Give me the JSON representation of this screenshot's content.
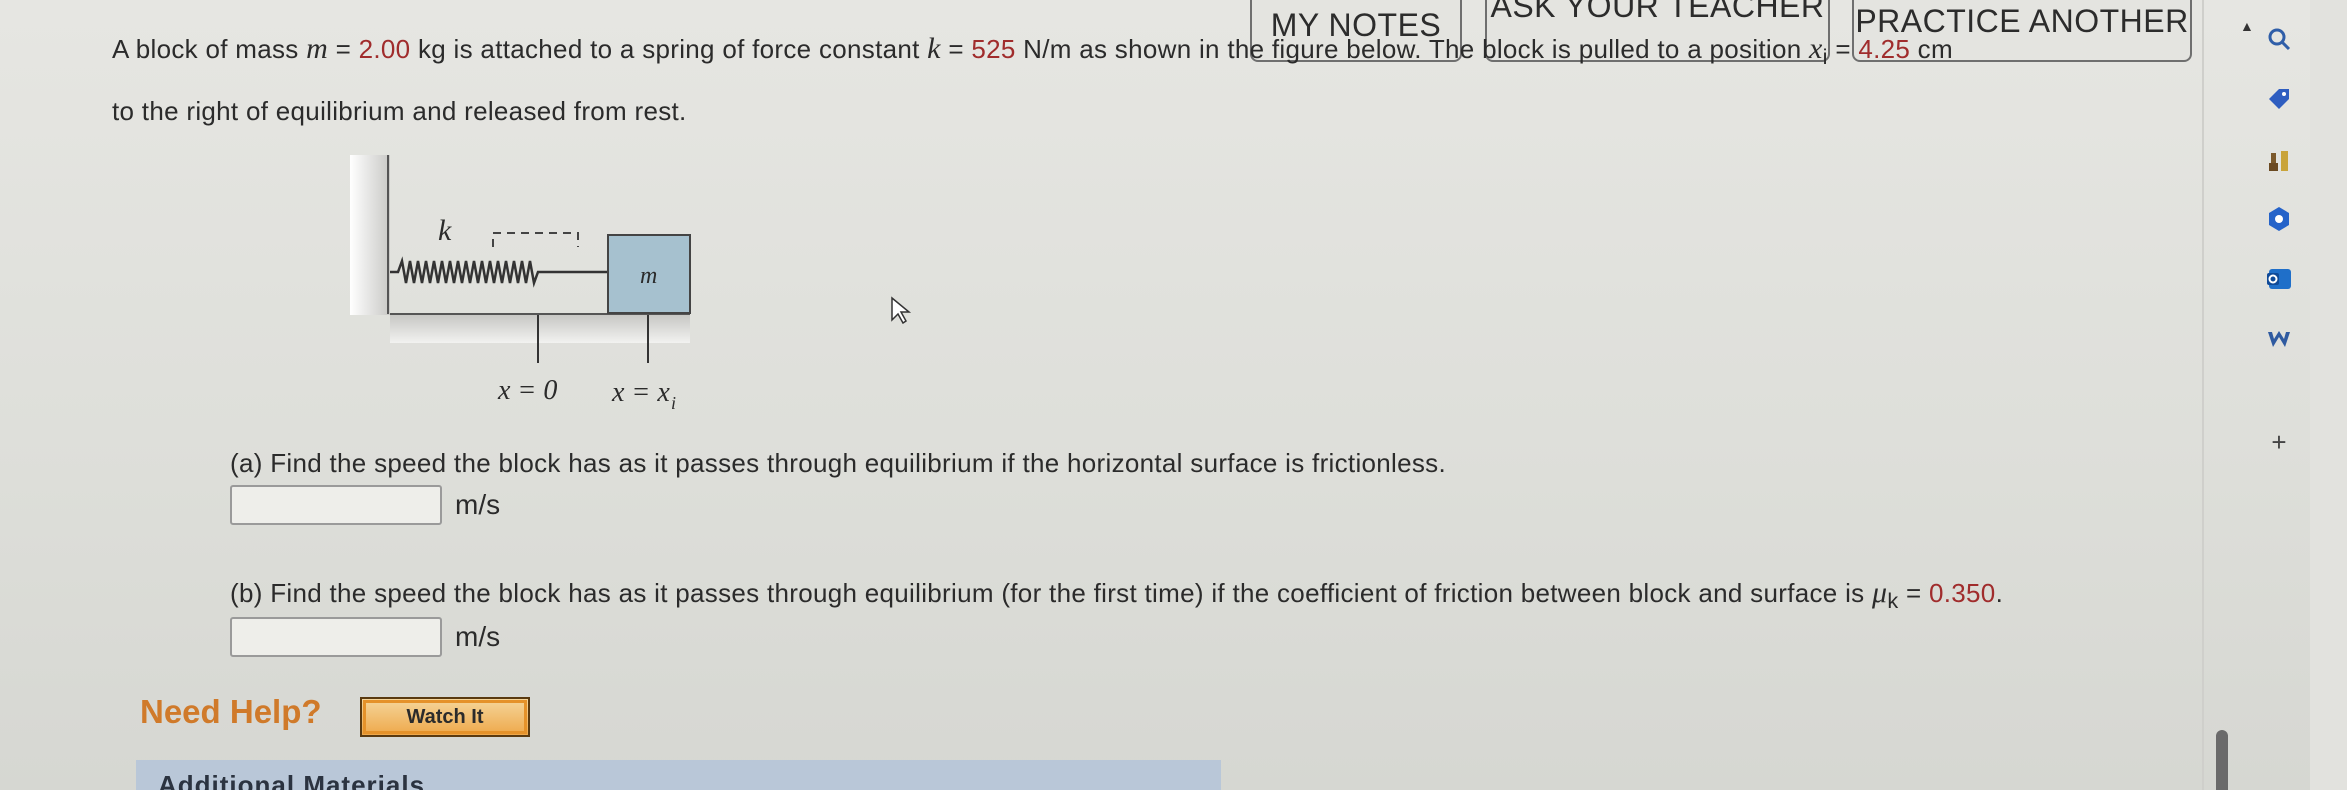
{
  "header": {
    "my_notes_label": "MY NOTES",
    "ask_teacher_label": "ASK YOUR TEACHER",
    "practice_label": "PRACTICE ANOTHER"
  },
  "problem": {
    "line1_a": "A block of mass ",
    "mass_var": "m",
    "line1_b": " = ",
    "mass_value": "2.00",
    "line1_c": " kg is attached to a spring of force constant ",
    "k_var": "k",
    "line1_d": " = ",
    "k_value": "525",
    "line1_e": " N/m as shown in the figure below. The block is pulled to a position ",
    "xi_var": "x",
    "xi_sub": "i",
    "line1_f": " = ",
    "xi_value": "4.25",
    "line1_g": " cm",
    "line2": "to the right of equilibrium and released from rest."
  },
  "figure": {
    "spring_label": "k",
    "block_label": "m",
    "x0_label": "x = 0",
    "xi_label": "x = x",
    "xi_label_sub": "i"
  },
  "part_a": {
    "text": "(a) Find the speed the block has as it passes through equilibrium if the horizontal surface is frictionless.",
    "unit": "m/s",
    "value": ""
  },
  "part_b": {
    "text_a": "(b) Find the speed the block has as it passes through equilibrium (for the first time) if the coefficient of friction between block and surface is ",
    "mu_var": "μ",
    "mu_sub": "k",
    "text_b": " = ",
    "mu_value": "0.350",
    "text_c": ".",
    "unit": "m/s",
    "value": ""
  },
  "help": {
    "need_help_label": "Need Help?",
    "watch_label": "Watch It",
    "additional_label": "Additional Materials"
  },
  "sidebar": {
    "icons": [
      "search-icon",
      "tag-icon",
      "chess-icon",
      "settings-icon",
      "outlook-icon",
      "w-icon",
      "add-icon"
    ],
    "add_glyph": "+"
  }
}
